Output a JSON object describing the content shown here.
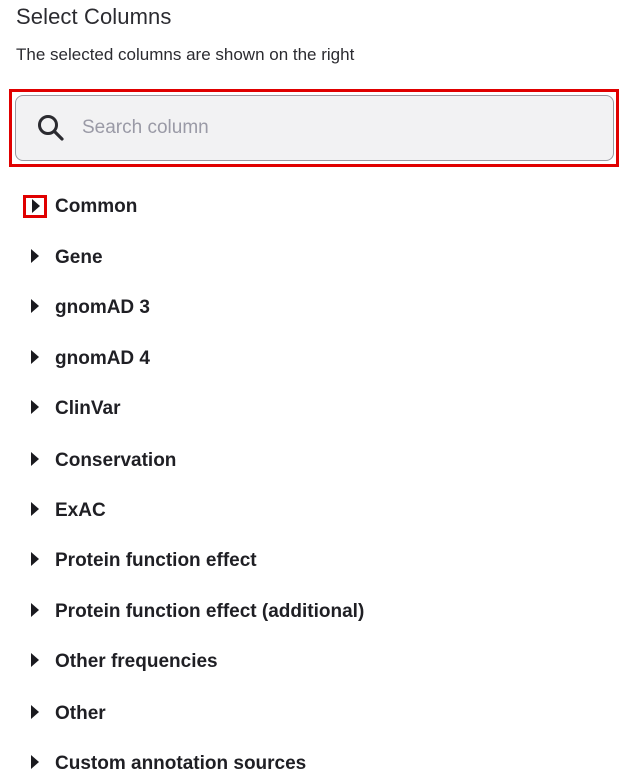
{
  "header": {
    "title": "Select Columns",
    "subtitle": "The selected columns are shown on the right"
  },
  "search": {
    "placeholder": "Search column",
    "value": "",
    "icon": "search-icon"
  },
  "groups": [
    {
      "label": "Common",
      "expanded": false,
      "highlighted": true
    },
    {
      "label": "Gene",
      "expanded": false
    },
    {
      "label": "gnomAD 3",
      "expanded": false
    },
    {
      "label": "gnomAD 4",
      "expanded": false
    },
    {
      "label": "ClinVar",
      "expanded": false
    },
    {
      "label": "Conservation",
      "expanded": false
    },
    {
      "label": "ExAC",
      "expanded": false
    },
    {
      "label": "Protein function effect",
      "expanded": false
    },
    {
      "label": "Protein function effect (additional)",
      "expanded": false
    },
    {
      "label": "Other frequencies",
      "expanded": false
    },
    {
      "label": "Other",
      "expanded": false
    },
    {
      "label": "Custom annotation sources",
      "expanded": false
    }
  ],
  "colors": {
    "highlight": "#e00000",
    "text": "#1f1f24",
    "search_bg": "#f2f2f3",
    "placeholder": "#9a9aa6"
  }
}
